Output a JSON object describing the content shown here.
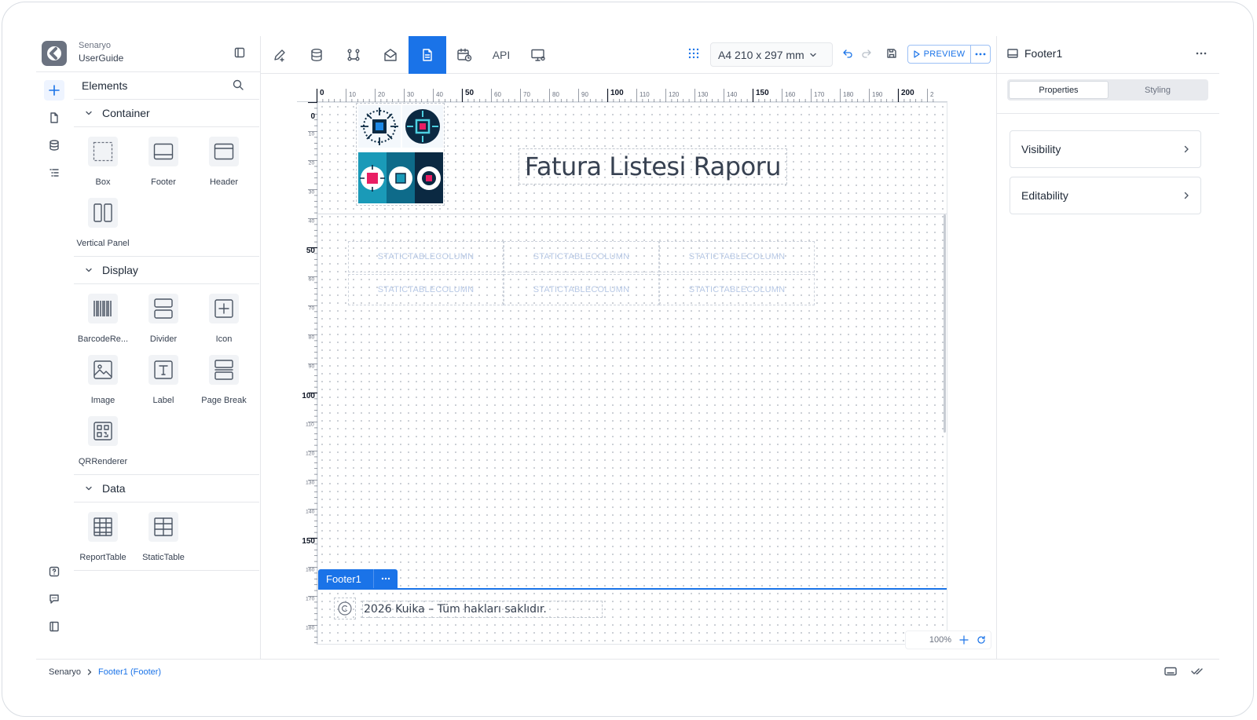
{
  "app": {
    "scenario_label": "Senaryo",
    "project_name": "UserGuide"
  },
  "elements_panel": {
    "title": "Elements",
    "sections": [
      {
        "title": "Container",
        "items": [
          "Box",
          "Footer",
          "Header",
          "Vertical Panel"
        ]
      },
      {
        "title": "Display",
        "items": [
          "BarcodeRe...",
          "Divider",
          "Icon",
          "Image",
          "Label",
          "Page Break",
          "QRRenderer"
        ]
      },
      {
        "title": "Data",
        "items": [
          "ReportTable",
          "StaticTable"
        ]
      }
    ]
  },
  "toolbar": {
    "api_label": "API",
    "page_size": "A4 210 x 297 mm",
    "preview_label": "PREVIEW",
    "accent_color": "#1a73e8"
  },
  "canvas": {
    "report_title": "Fatura Listesi Raporu",
    "static_table_cells": [
      [
        "STATICTABLECOLUMN",
        "STATICTABLECOLUMN",
        "STATICTABLECOLUMN"
      ],
      [
        "STATICTABLECOLUMN",
        "STATICTABLECOLUMN",
        "STATICTABLECOLUMN"
      ]
    ],
    "footer_tag": "Footer1",
    "footer_text": "2026 Kuika – Tüm hakları saklıdır.",
    "zoom": "100%",
    "ruler_top_labels": [
      "0",
      "10",
      "20",
      "30",
      "40",
      "50",
      "60",
      "70",
      "80",
      "90",
      "100",
      "110",
      "120",
      "130",
      "140",
      "150",
      "160",
      "170",
      "180",
      "190",
      "200",
      "2"
    ],
    "ruler_left_labels": [
      "0",
      "10",
      "20",
      "30",
      "40",
      "50",
      "60",
      "70",
      "80",
      "90",
      "100",
      "110",
      "120",
      "130",
      "140",
      "150",
      "160",
      "170",
      "180"
    ]
  },
  "right_panel": {
    "selected_component": "Footer1",
    "tabs": [
      "Properties",
      "Styling"
    ],
    "sections": [
      "Visibility",
      "Editability"
    ]
  },
  "breadcrumb": {
    "root": "Senaryo",
    "current": "Footer1 (Footer)"
  }
}
